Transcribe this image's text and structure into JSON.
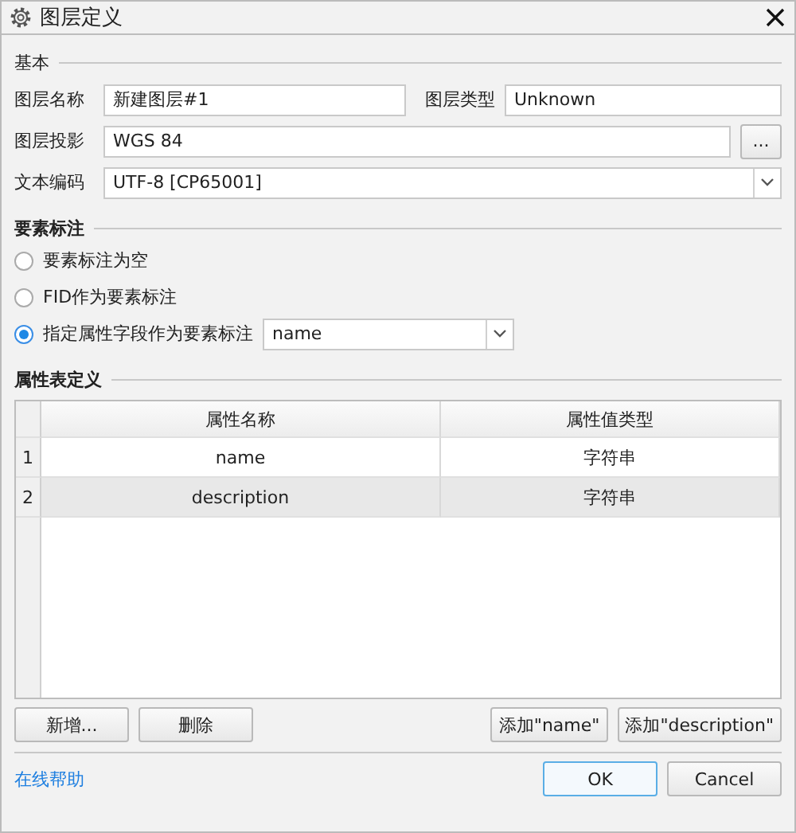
{
  "window": {
    "title": "图层定义"
  },
  "basic": {
    "title": "基本",
    "fields": [
      {
        "label": "图层名称",
        "value": "新建图层#1"
      },
      {
        "label": "图层类型",
        "value": "Unknown"
      }
    ],
    "projection": {
      "label": "图层投影",
      "value": "WGS 84",
      "browse": "..."
    },
    "encoding": {
      "label": "文本编码",
      "value": "UTF-8 [CP65001]"
    }
  },
  "labeling": {
    "title": "要素标注",
    "options": [
      {
        "label": "要素标注为空",
        "selected": false
      },
      {
        "label": "FID作为要素标注",
        "selected": false
      },
      {
        "label": "指定属性字段作为要素标注",
        "selected": true,
        "field": "name"
      }
    ]
  },
  "attributes": {
    "title": "属性表定义",
    "columns": [
      "属性名称",
      "属性值类型"
    ],
    "rows": [
      {
        "index": "1",
        "name": "name",
        "type": "字符串",
        "selected": false
      },
      {
        "index": "2",
        "name": "description",
        "type": "字符串",
        "selected": true
      }
    ],
    "buttons_left": [
      "新增...",
      "删除"
    ],
    "buttons_right": [
      "添加\"name\"",
      "添加\"description\""
    ]
  },
  "footer": {
    "help_link": "在线帮助",
    "buttons": [
      "OK",
      "Cancel"
    ]
  }
}
